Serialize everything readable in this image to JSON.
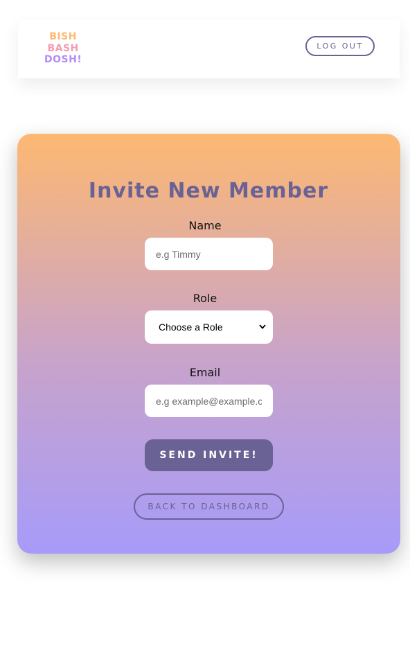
{
  "header": {
    "logo_lines": [
      "BISH",
      "BASH",
      "DOSH!"
    ],
    "logo_colors": [
      "#fdb872",
      "#f59cb0",
      "#b48cf6"
    ],
    "logout_label": "LOG OUT"
  },
  "form": {
    "title": "Invite New Member",
    "name_label": "Name",
    "name_placeholder": "e.g Timmy",
    "role_label": "Role",
    "role_selected": "Choose a Role",
    "email_label": "Email",
    "email_placeholder": "e.g example@example.com",
    "send_label": "SEND INVITE!",
    "back_label": "BACK TO DASHBOARD"
  },
  "colors": {
    "accent": "#6a6194",
    "gradient_top": "#fdb872",
    "gradient_bottom": "#a79bf9"
  }
}
